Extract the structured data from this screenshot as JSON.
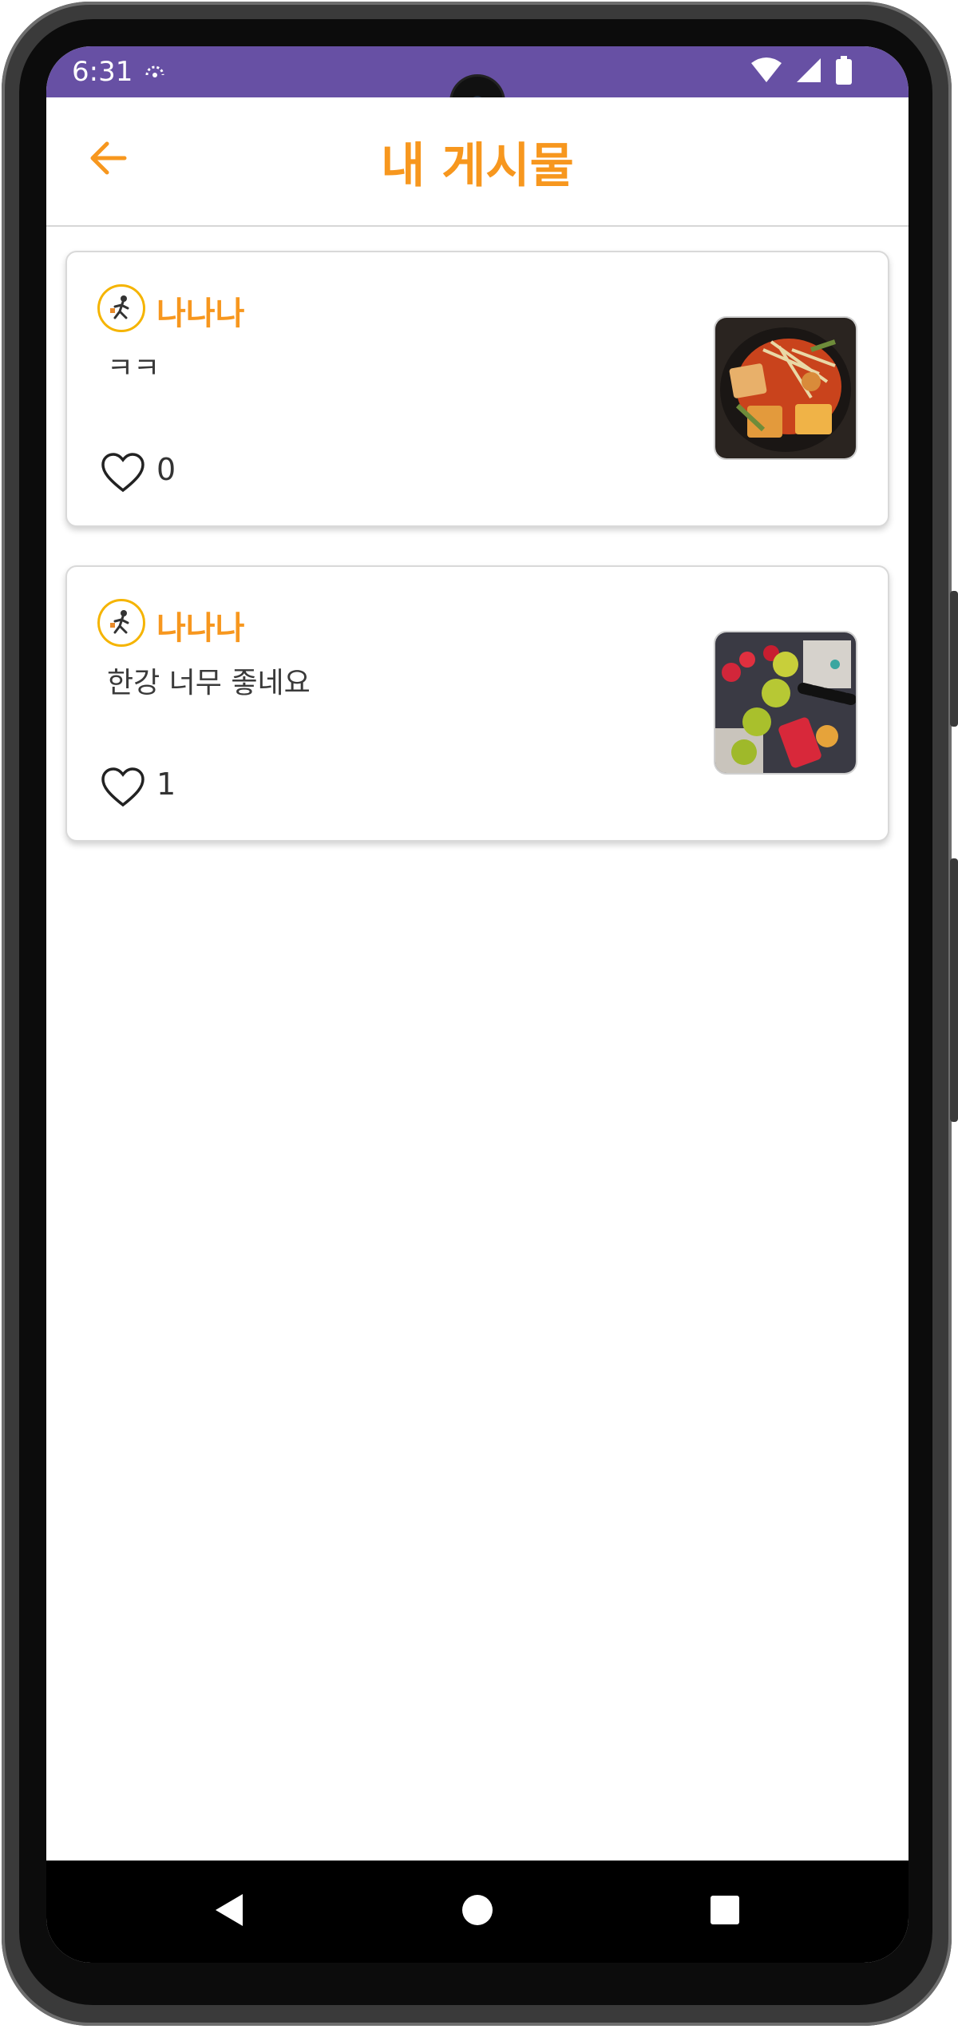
{
  "status_bar": {
    "time": "6:31",
    "icons": [
      "network-activity-icon",
      "wifi-icon",
      "signal-icon",
      "battery-icon"
    ],
    "color": "#6750a4"
  },
  "header": {
    "title": "내 게시물",
    "back_icon": "arrow-left-icon",
    "accent_color": "#f7971e"
  },
  "posts": [
    {
      "author": "나나나",
      "content": "ㅋㅋ",
      "likes": "0",
      "avatar_icon": "person-avatar-icon",
      "like_icon": "heart-outline-icon",
      "image": "food-photo-tteokbokki"
    },
    {
      "author": "나나나",
      "content": "한강 너무 좋네요",
      "likes": "1",
      "avatar_icon": "person-avatar-icon",
      "like_icon": "heart-outline-icon",
      "image": "food-photo-fruit-skewers"
    }
  ],
  "nav_bar": {
    "icons": [
      "nav-back-icon",
      "nav-home-icon",
      "nav-recents-icon"
    ]
  }
}
